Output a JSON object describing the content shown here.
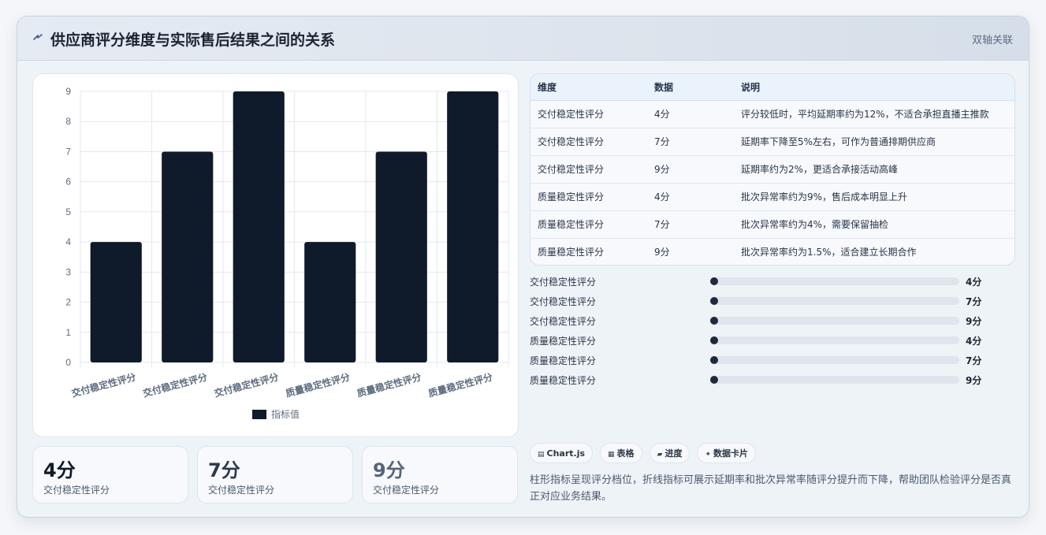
{
  "header": {
    "title": "供应商评分维度与实际售后结果之间的关系",
    "tag": "双轴关联"
  },
  "chart_data": {
    "type": "bar",
    "categories": [
      "交付稳定性评分",
      "交付稳定性评分",
      "交付稳定性评分",
      "质量稳定性评分",
      "质量稳定性评分",
      "质量稳定性评分"
    ],
    "series": [
      {
        "name": "指标值",
        "values": [
          4,
          7,
          9,
          4,
          7,
          9
        ]
      }
    ],
    "yticks": [
      "0",
      "1",
      "2",
      "3",
      "4",
      "5",
      "6",
      "7",
      "8",
      "9"
    ],
    "ylim": [
      0,
      9
    ],
    "grid": true,
    "legend": "bottom",
    "colors": {
      "bar": "#0f1a2b",
      "grid": "#e3e8ee",
      "axis_text": "#5e6c80"
    }
  },
  "stats": [
    {
      "value": "4分",
      "label": "交付稳定性评分",
      "color": "#111a2a"
    },
    {
      "value": "7分",
      "label": "交付稳定性评分",
      "color": "#2d394c"
    },
    {
      "value": "9分",
      "label": "交付稳定性评分",
      "color": "#56647a"
    }
  ],
  "table": {
    "headers": [
      "维度",
      "数据",
      "说明"
    ],
    "rows": [
      [
        "交付稳定性评分",
        "4分",
        "评分较低时，平均延期率约为12%，不适合承担直播主推款"
      ],
      [
        "交付稳定性评分",
        "7分",
        "延期率下降至5%左右，可作为普通排期供应商"
      ],
      [
        "交付稳定性评分",
        "9分",
        "延期率约为2%，更适合承接活动高峰"
      ],
      [
        "质量稳定性评分",
        "4分",
        "批次异常率约为9%，售后成本明显上升"
      ],
      [
        "质量稳定性评分",
        "7分",
        "批次异常率约为4%，需要保留抽检"
      ],
      [
        "质量稳定性评分",
        "9分",
        "批次异常率约为1.5%，适合建立长期合作"
      ]
    ]
  },
  "progress": [
    {
      "label": "交付稳定性评分",
      "value": "4分",
      "fraction": 0.02
    },
    {
      "label": "交付稳定性评分",
      "value": "7分",
      "fraction": 0.02
    },
    {
      "label": "交付稳定性评分",
      "value": "9分",
      "fraction": 0.02
    },
    {
      "label": "质量稳定性评分",
      "value": "4分",
      "fraction": 0.02
    },
    {
      "label": "质量稳定性评分",
      "value": "7分",
      "fraction": 0.02
    },
    {
      "label": "质量稳定性评分",
      "value": "9分",
      "fraction": 0.02
    }
  ],
  "chips": [
    {
      "icon": "chart-icon",
      "glyph": "▤",
      "label": "Chart.js"
    },
    {
      "icon": "table-icon",
      "glyph": "▦",
      "label": "表格"
    },
    {
      "icon": "progress-icon",
      "glyph": "▰",
      "label": "进度"
    },
    {
      "icon": "card-icon",
      "glyph": "✦",
      "label": "数据卡片"
    }
  ],
  "description": "柱形指标呈现评分档位，折线指标可展示延期率和批次异常率随评分提升而下降，帮助团队检验评分是否真正对应业务结果。"
}
